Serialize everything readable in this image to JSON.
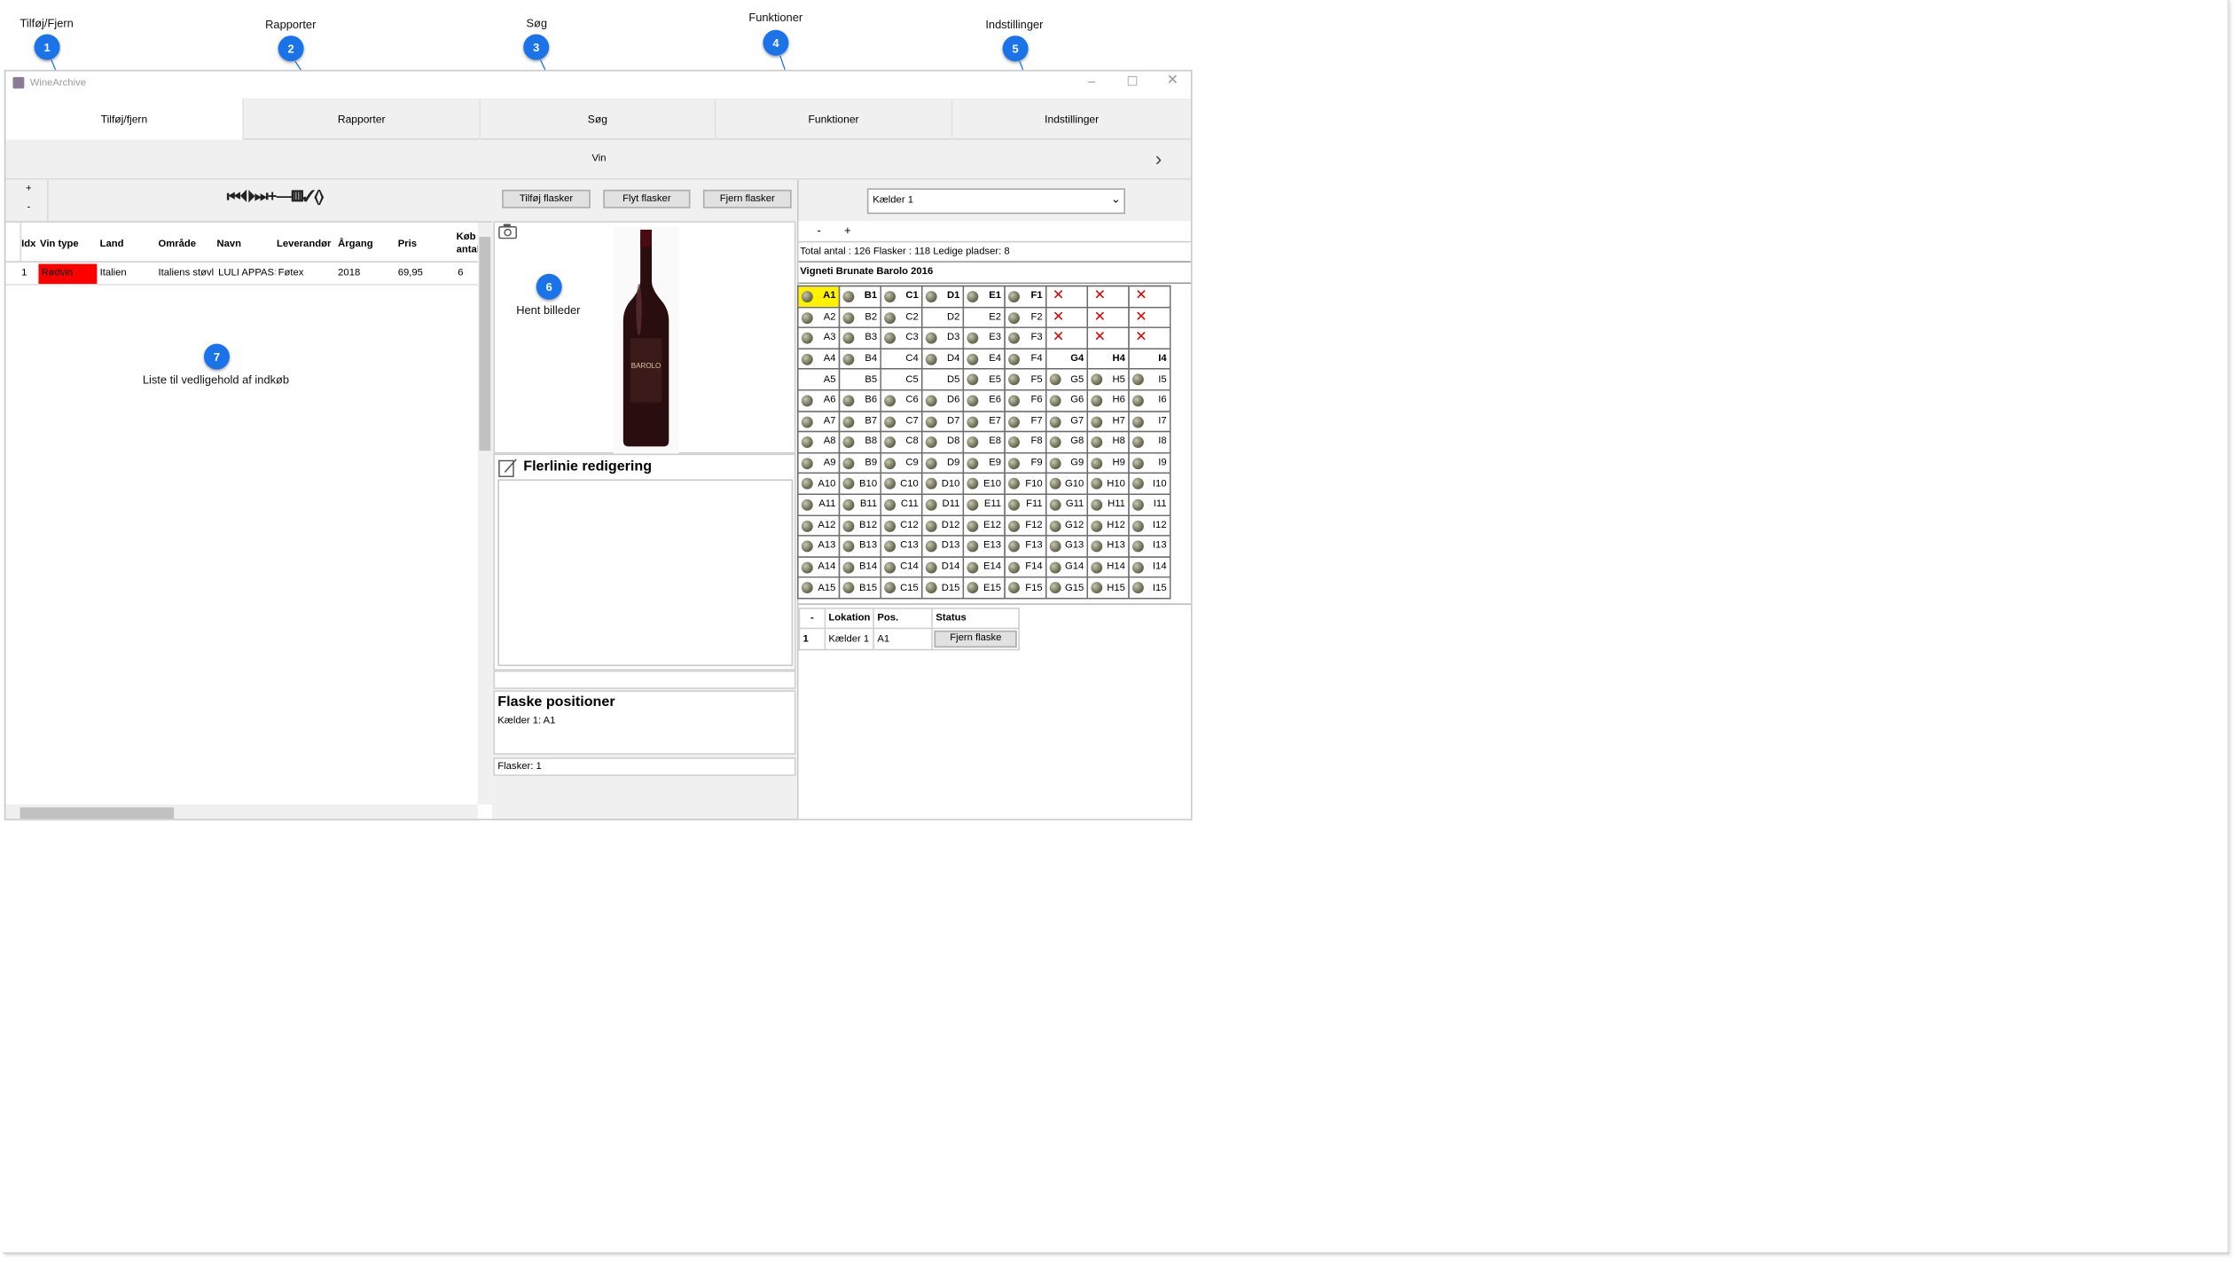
{
  "callouts": [
    {
      "num": "1",
      "label": "Tilføj/Fjern"
    },
    {
      "num": "2",
      "label": "Rapporter"
    },
    {
      "num": "3",
      "label": "Søg"
    },
    {
      "num": "4",
      "label": "Funktioner"
    },
    {
      "num": "5",
      "label": "Indstillinger"
    },
    {
      "num": "6",
      "label": "Hent billeder"
    },
    {
      "num": "7",
      "label": "Liste til vedligehold af indkøb"
    }
  ],
  "window": {
    "title": "WineArchive"
  },
  "tabs": [
    "Tilføj/fjern",
    "Rapporter",
    "Søg",
    "Funktioner",
    "Indstillinger"
  ],
  "section_title": "Vin",
  "small_buttons": {
    "plus": "+",
    "minus": "-"
  },
  "nav_toolbar": "⏮⏴⏵⏭+—▥✓⟨⟩",
  "actions": {
    "add": "Tilføj flasker",
    "move": "Flyt flasker",
    "remove": "Fjern flasker"
  },
  "cellar_select": "Kælder 1",
  "zoom": {
    "minus": "-",
    "plus": "+"
  },
  "table": {
    "columns": [
      "Idx",
      "Vin type",
      "Land",
      "Område",
      "Navn",
      "Leverandør",
      "Årgang",
      "Pris",
      "Køb antal"
    ],
    "rows": [
      [
        "1",
        "Rødvin",
        "Italien",
        "Italiens støvl",
        "LULI APPASS",
        "Føtex",
        "2018",
        "69,95",
        "6"
      ]
    ]
  },
  "multiline": {
    "title": "Flerlinie redigering"
  },
  "positions": {
    "title": "Flaske positioner",
    "value": "Kælder 1: A1",
    "count": "Flasker: 1"
  },
  "stats": "Total antal : 126  Flasker : 118  Ledige pladser: 8",
  "wine_name": "Vigneti Brunate Barolo 2016",
  "bottle": {
    "label": "BAROLO"
  },
  "loc_table": {
    "cols": [
      "-",
      "Lokation",
      "Pos.",
      "Status"
    ],
    "row": {
      "num": "1",
      "loc": "Kælder 1",
      "pos": "A1",
      "button": "Fjern flaske"
    }
  },
  "colors": {
    "accent": "#1a73e8",
    "selected_cell": "#fff200",
    "wine_type_bg": "#ff0000",
    "remove_mark": "#e00000"
  }
}
